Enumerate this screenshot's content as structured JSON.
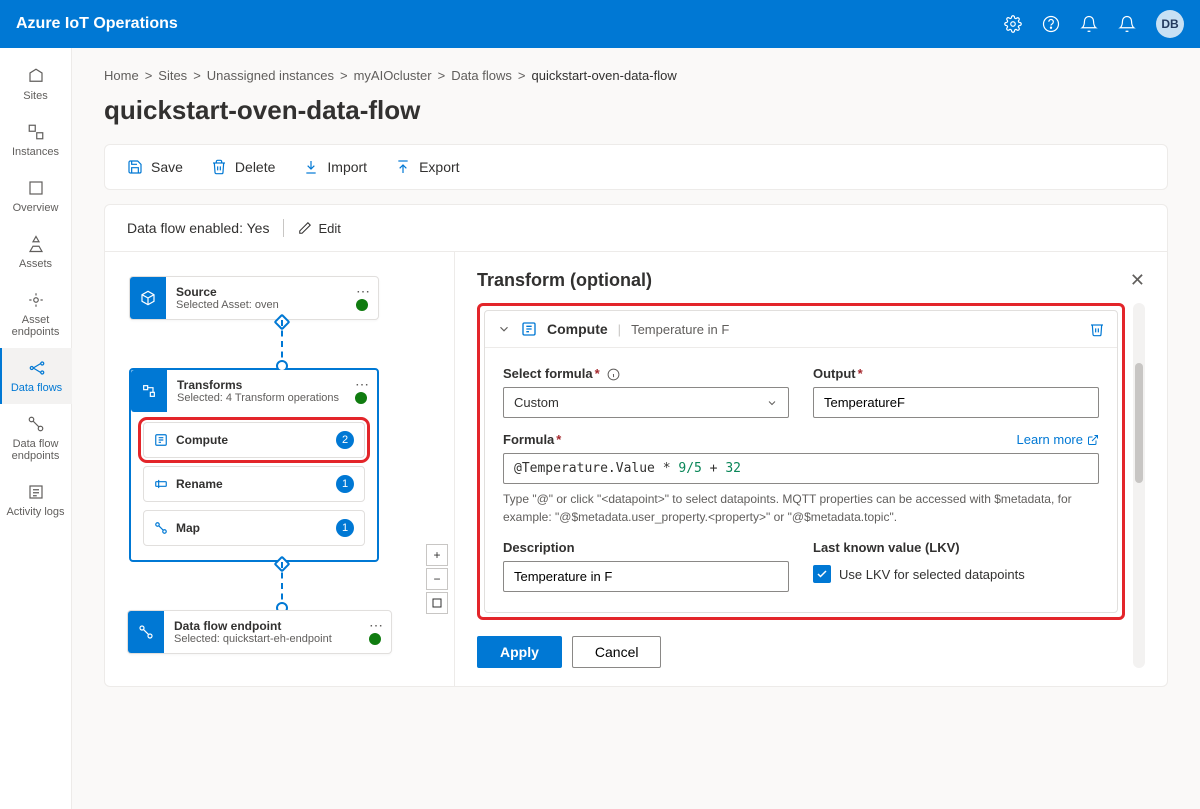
{
  "app": {
    "title": "Azure IoT Operations",
    "avatar": "DB"
  },
  "nav": {
    "items": [
      {
        "label": "Sites"
      },
      {
        "label": "Instances"
      },
      {
        "label": "Overview"
      },
      {
        "label": "Assets"
      },
      {
        "label": "Asset endpoints"
      },
      {
        "label": "Data flows"
      },
      {
        "label": "Data flow endpoints"
      },
      {
        "label": "Activity logs"
      }
    ]
  },
  "breadcrumb": {
    "home": "Home",
    "sites": "Sites",
    "unassigned": "Unassigned instances",
    "cluster": "myAIOcluster",
    "dataflows": "Data flows",
    "current": "quickstart-oven-data-flow"
  },
  "page": {
    "title": "quickstart-oven-data-flow"
  },
  "toolbar": {
    "save": "Save",
    "delete": "Delete",
    "import": "Import",
    "export": "Export"
  },
  "enable": {
    "label": "Data flow enabled:",
    "value": "Yes",
    "edit": "Edit"
  },
  "canvas": {
    "source": {
      "title": "Source",
      "sub": "Selected Asset: oven"
    },
    "transforms": {
      "title": "Transforms",
      "sub": "Selected: 4 Transform operations",
      "ops": [
        {
          "name": "Compute",
          "count": "2"
        },
        {
          "name": "Rename",
          "count": "1"
        },
        {
          "name": "Map",
          "count": "1"
        }
      ]
    },
    "endpoint": {
      "title": "Data flow endpoint",
      "sub": "Selected: quickstart-eh-endpoint"
    }
  },
  "pane": {
    "title": "Transform (optional)",
    "compute": {
      "label": "Compute",
      "subtitle": "Temperature in F"
    },
    "formula": {
      "label": "Select formula",
      "value": "Custom"
    },
    "output": {
      "label": "Output",
      "value": "TemperatureF"
    },
    "formula_field": {
      "label": "Formula",
      "learn_more": "Learn more",
      "value_prefix": "@Temperature.Value * ",
      "value_frac": "9/5",
      "value_mid": " + ",
      "value_num": "32",
      "hint": "Type \"@\" or click \"<datapoint>\" to select datapoints. MQTT properties can be accessed with $metadata, for example: \"@$metadata.user_property.<property>\" or \"@$metadata.topic\"."
    },
    "description": {
      "label": "Description",
      "value": "Temperature in F"
    },
    "lkv": {
      "label": "Last known value (LKV)",
      "checkbox": "Use LKV for selected datapoints"
    },
    "buttons": {
      "apply": "Apply",
      "cancel": "Cancel"
    }
  }
}
